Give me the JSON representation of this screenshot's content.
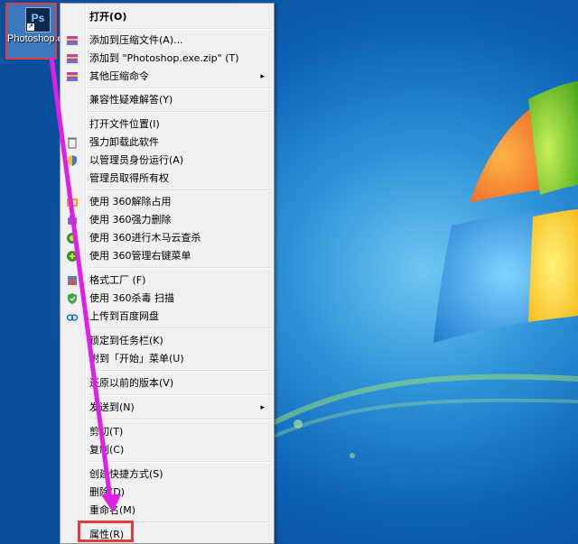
{
  "desktop_icon": {
    "label": "Photoshop.exe"
  },
  "context_menu": {
    "items": [
      {
        "label": "打开(O)",
        "icon": ""
      },
      {
        "label": "添加到压缩文件(A)...",
        "icon": "winrar-icon"
      },
      {
        "label": "添加到 \"Photoshop.exe.zip\" (T)",
        "icon": "winrar-icon"
      },
      {
        "label": "其他压缩命令",
        "icon": "winrar-icon",
        "submenu": "▸"
      },
      {
        "label": "兼容性疑难解答(Y)",
        "icon": ""
      },
      {
        "label": "打开文件位置(I)",
        "icon": ""
      },
      {
        "label": "强力卸载此软件",
        "icon": "trash-icon"
      },
      {
        "label": "以管理员身份运行(A)",
        "icon": "uac-shield-icon"
      },
      {
        "label": "管理员取得所有权",
        "icon": ""
      },
      {
        "label": "使用 360解除占用",
        "icon": "360-unlock-icon"
      },
      {
        "label": "使用 360强力删除",
        "icon": "360-delete-icon"
      },
      {
        "label": "使用 360进行木马云查杀",
        "icon": "360-scan-icon"
      },
      {
        "label": "使用 360管理右键菜单",
        "icon": "360-menu-icon"
      },
      {
        "label": "格式工厂 (F)",
        "icon": "format-factory-icon"
      },
      {
        "label": "使用 360杀毒 扫描",
        "icon": "360-antivirus-icon"
      },
      {
        "label": "上传到百度网盘",
        "icon": "baidu-netdisk-icon"
      },
      {
        "label": "锁定到任务栏(K)",
        "icon": ""
      },
      {
        "label": "附到「开始」菜单(U)",
        "icon": ""
      },
      {
        "label": "还原以前的版本(V)",
        "icon": ""
      },
      {
        "label": "发送到(N)",
        "icon": "",
        "submenu": "▸"
      },
      {
        "label": "剪切(T)",
        "icon": ""
      },
      {
        "label": "复制(C)",
        "icon": ""
      },
      {
        "label": "创建快捷方式(S)",
        "icon": ""
      },
      {
        "label": "删除(D)",
        "icon": ""
      },
      {
        "label": "重命名(M)",
        "icon": ""
      },
      {
        "label": "属性(R)",
        "icon": ""
      }
    ]
  },
  "colors": {
    "highlight_box": "#e43a3a",
    "arrow": "#e11ee8",
    "menu_bg": "#f0f0f0"
  }
}
